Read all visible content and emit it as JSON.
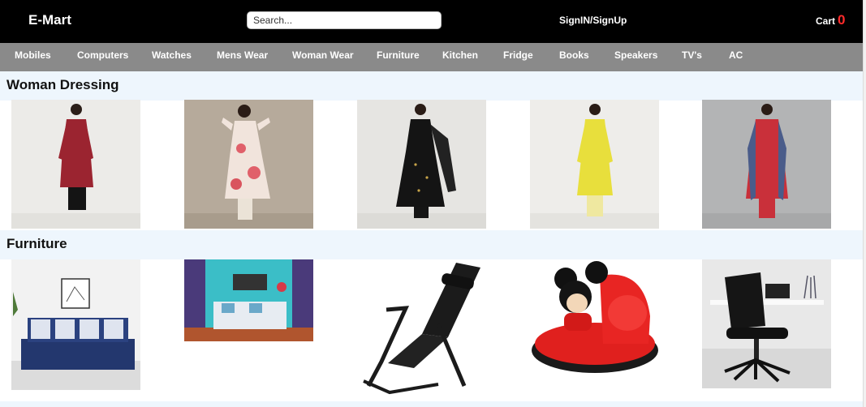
{
  "header": {
    "brand": "E-Mart",
    "search_placeholder": "Search...",
    "signin_label": "SignIN/SignUp",
    "cart_label": "Cart",
    "cart_count": "0"
  },
  "nav": {
    "items": [
      "Mobiles",
      "Computers",
      "Watches",
      "Mens Wear",
      "Woman Wear",
      "Furniture",
      "Kitchen",
      "Fridge",
      "Books",
      "Speakers",
      "TV's",
      "AC"
    ]
  },
  "sections": [
    {
      "title": "Woman Dressing"
    },
    {
      "title": "Furniture"
    }
  ],
  "colors": {
    "header_bg": "#000000",
    "nav_bg": "#8a8a8a",
    "section_bg": "#eef6fd",
    "cart_count": "#ff2b2b"
  }
}
